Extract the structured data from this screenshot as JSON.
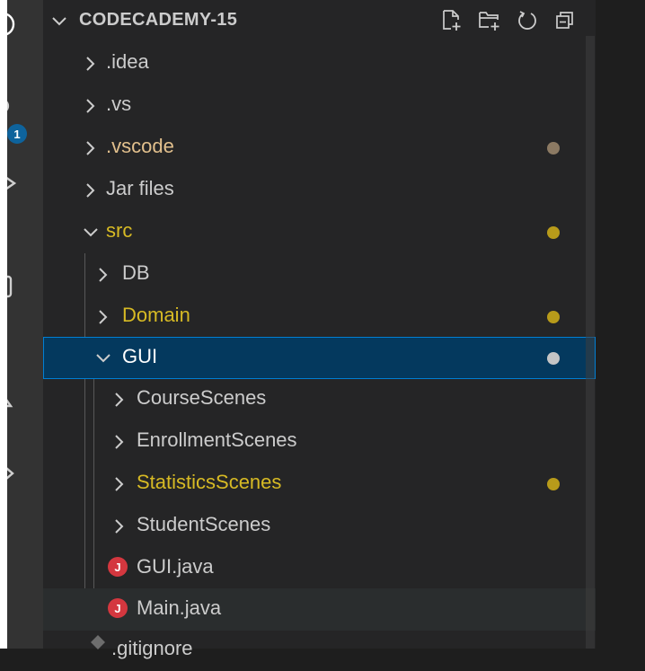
{
  "explorer": {
    "title": "CODECADEMY-15",
    "action_icons": [
      "new-file-icon",
      "new-folder-icon",
      "refresh-icon",
      "collapse-all-icon"
    ]
  },
  "activity_bar": {
    "badge": "1"
  },
  "tree": [
    {
      "label": ".idea",
      "type": "folder",
      "expanded": false,
      "color": "#cccccc",
      "dot": null
    },
    {
      "label": ".vs",
      "type": "folder",
      "expanded": false,
      "color": "#cccccc",
      "dot": null
    },
    {
      "label": ".vscode",
      "type": "folder",
      "expanded": false,
      "color": "#e2c08d",
      "dot": "#8c7a63"
    },
    {
      "label": "Jar files",
      "type": "folder",
      "expanded": false,
      "color": "#cccccc",
      "dot": null
    },
    {
      "label": "src",
      "type": "folder",
      "expanded": true,
      "color": "#d7ba24",
      "dot": "#b89b1a"
    },
    {
      "label": "DB",
      "type": "folder",
      "expanded": false,
      "color": "#cccccc",
      "dot": null
    },
    {
      "label": "Domain",
      "type": "folder",
      "expanded": false,
      "color": "#d7ba24",
      "dot": "#b89b1a"
    },
    {
      "label": "GUI",
      "type": "folder",
      "expanded": true,
      "color": "#ffffff",
      "dot": "#c5c5c5",
      "selected": true
    },
    {
      "label": "CourseScenes",
      "type": "folder",
      "expanded": false,
      "color": "#cccccc",
      "dot": null
    },
    {
      "label": "EnrollmentScenes",
      "type": "folder",
      "expanded": false,
      "color": "#cccccc",
      "dot": null
    },
    {
      "label": "StatisticsScenes",
      "type": "folder",
      "expanded": false,
      "color": "#d7ba24",
      "dot": "#b89b1a"
    },
    {
      "label": "StudentScenes",
      "type": "folder",
      "expanded": false,
      "color": "#cccccc",
      "dot": null
    },
    {
      "label": "GUI.java",
      "type": "java-file",
      "color": "#cccccc",
      "dot": null
    },
    {
      "label": "Main.java",
      "type": "java-file",
      "color": "#cccccc",
      "dot": null,
      "hover": true
    },
    {
      "label": ".gitignore",
      "type": "file",
      "color": "#cccccc",
      "dot": null
    }
  ],
  "colors": {
    "sidebar_bg": "#252526",
    "selection_bg": "#04395e",
    "selection_border": "#007fd4",
    "modified_folder": "#d7ba24",
    "java_icon": "#d4373f"
  }
}
